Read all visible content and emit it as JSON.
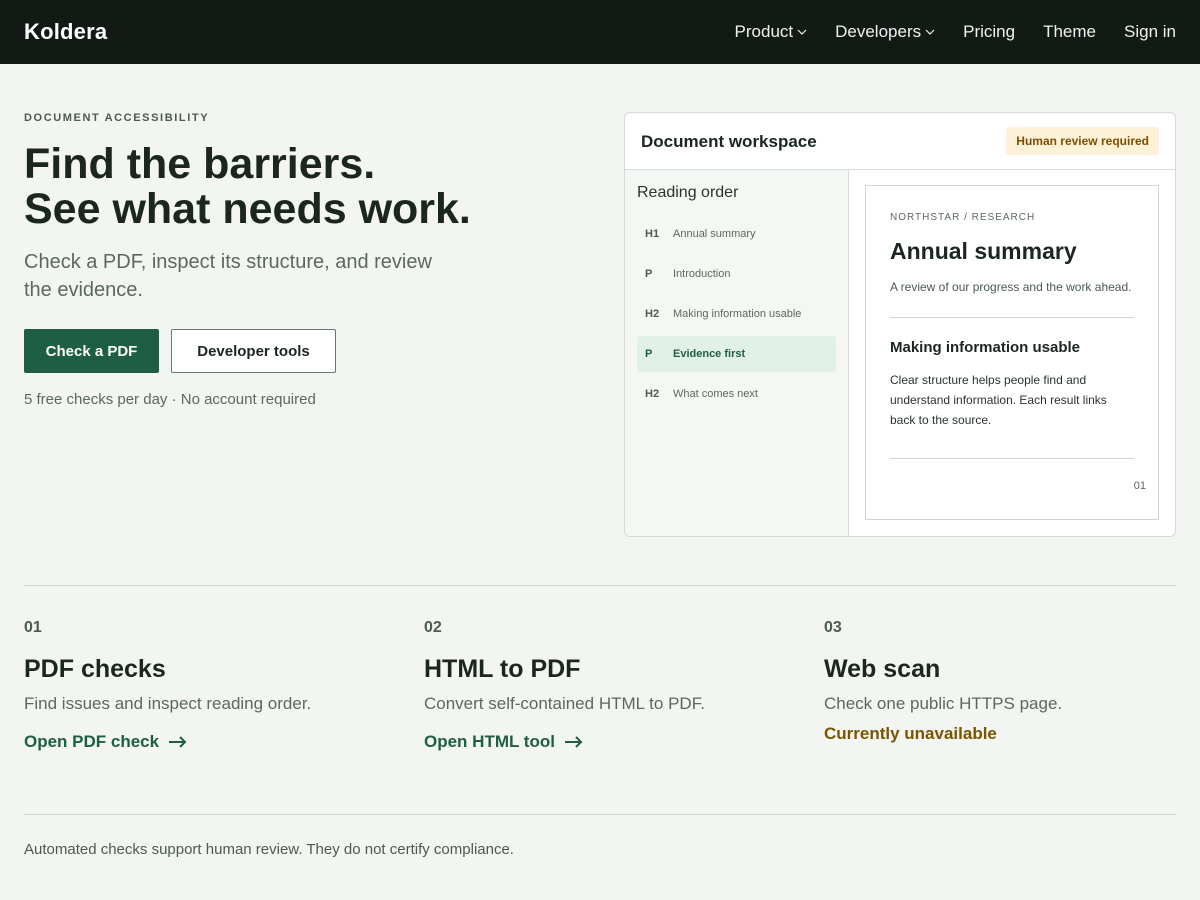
{
  "brand": "Koldera",
  "nav": {
    "product": "Product",
    "developers": "Developers",
    "pricing": "Pricing",
    "theme": "Theme",
    "sign_in": "Sign in"
  },
  "hero": {
    "eyebrow": "DOCUMENT ACCESSIBILITY",
    "title_line1": "Find the barriers.",
    "title_line2": "See what needs work.",
    "subtitle": "Check a PDF, inspect its structure, and review the evidence.",
    "primary_button": "Check a PDF",
    "secondary_button": "Developer tools",
    "note": "5 free checks per day · No account required"
  },
  "workspace": {
    "title": "Document workspace",
    "badge": "Human review required",
    "reading_order_title": "Reading order",
    "reading_order": [
      {
        "tag": "H1",
        "label": "Annual summary",
        "active": false
      },
      {
        "tag": "P",
        "label": "Introduction",
        "active": false
      },
      {
        "tag": "H2",
        "label": "Making information usable",
        "active": false
      },
      {
        "tag": "P",
        "label": "Evidence first",
        "active": true
      },
      {
        "tag": "H2",
        "label": "What comes next",
        "active": false
      }
    ],
    "document": {
      "kicker": "NORTHSTAR / RESEARCH",
      "title": "Annual summary",
      "description": "A review of our progress and the work ahead.",
      "heading2": "Making information usable",
      "body": "Clear structure helps people find and understand information. Each result links back to the source.",
      "page_number": "01"
    }
  },
  "features": [
    {
      "number": "01",
      "title": "PDF checks",
      "description": "Find issues and inspect reading order.",
      "link": "Open PDF check"
    },
    {
      "number": "02",
      "title": "HTML to PDF",
      "description": "Convert self-contained HTML to PDF.",
      "link": "Open HTML tool"
    },
    {
      "number": "03",
      "title": "Web scan",
      "description": "Check one public HTTPS page.",
      "status": "Currently unavailable"
    }
  ],
  "footer_note": "Automated checks support human review. They do not certify compliance.",
  "colors": {
    "topbar": "#131a16",
    "background": "#f3f5f2",
    "accent": "#1d5e45",
    "badge_bg": "#fdf1d8",
    "warning_text": "#7a5500"
  }
}
